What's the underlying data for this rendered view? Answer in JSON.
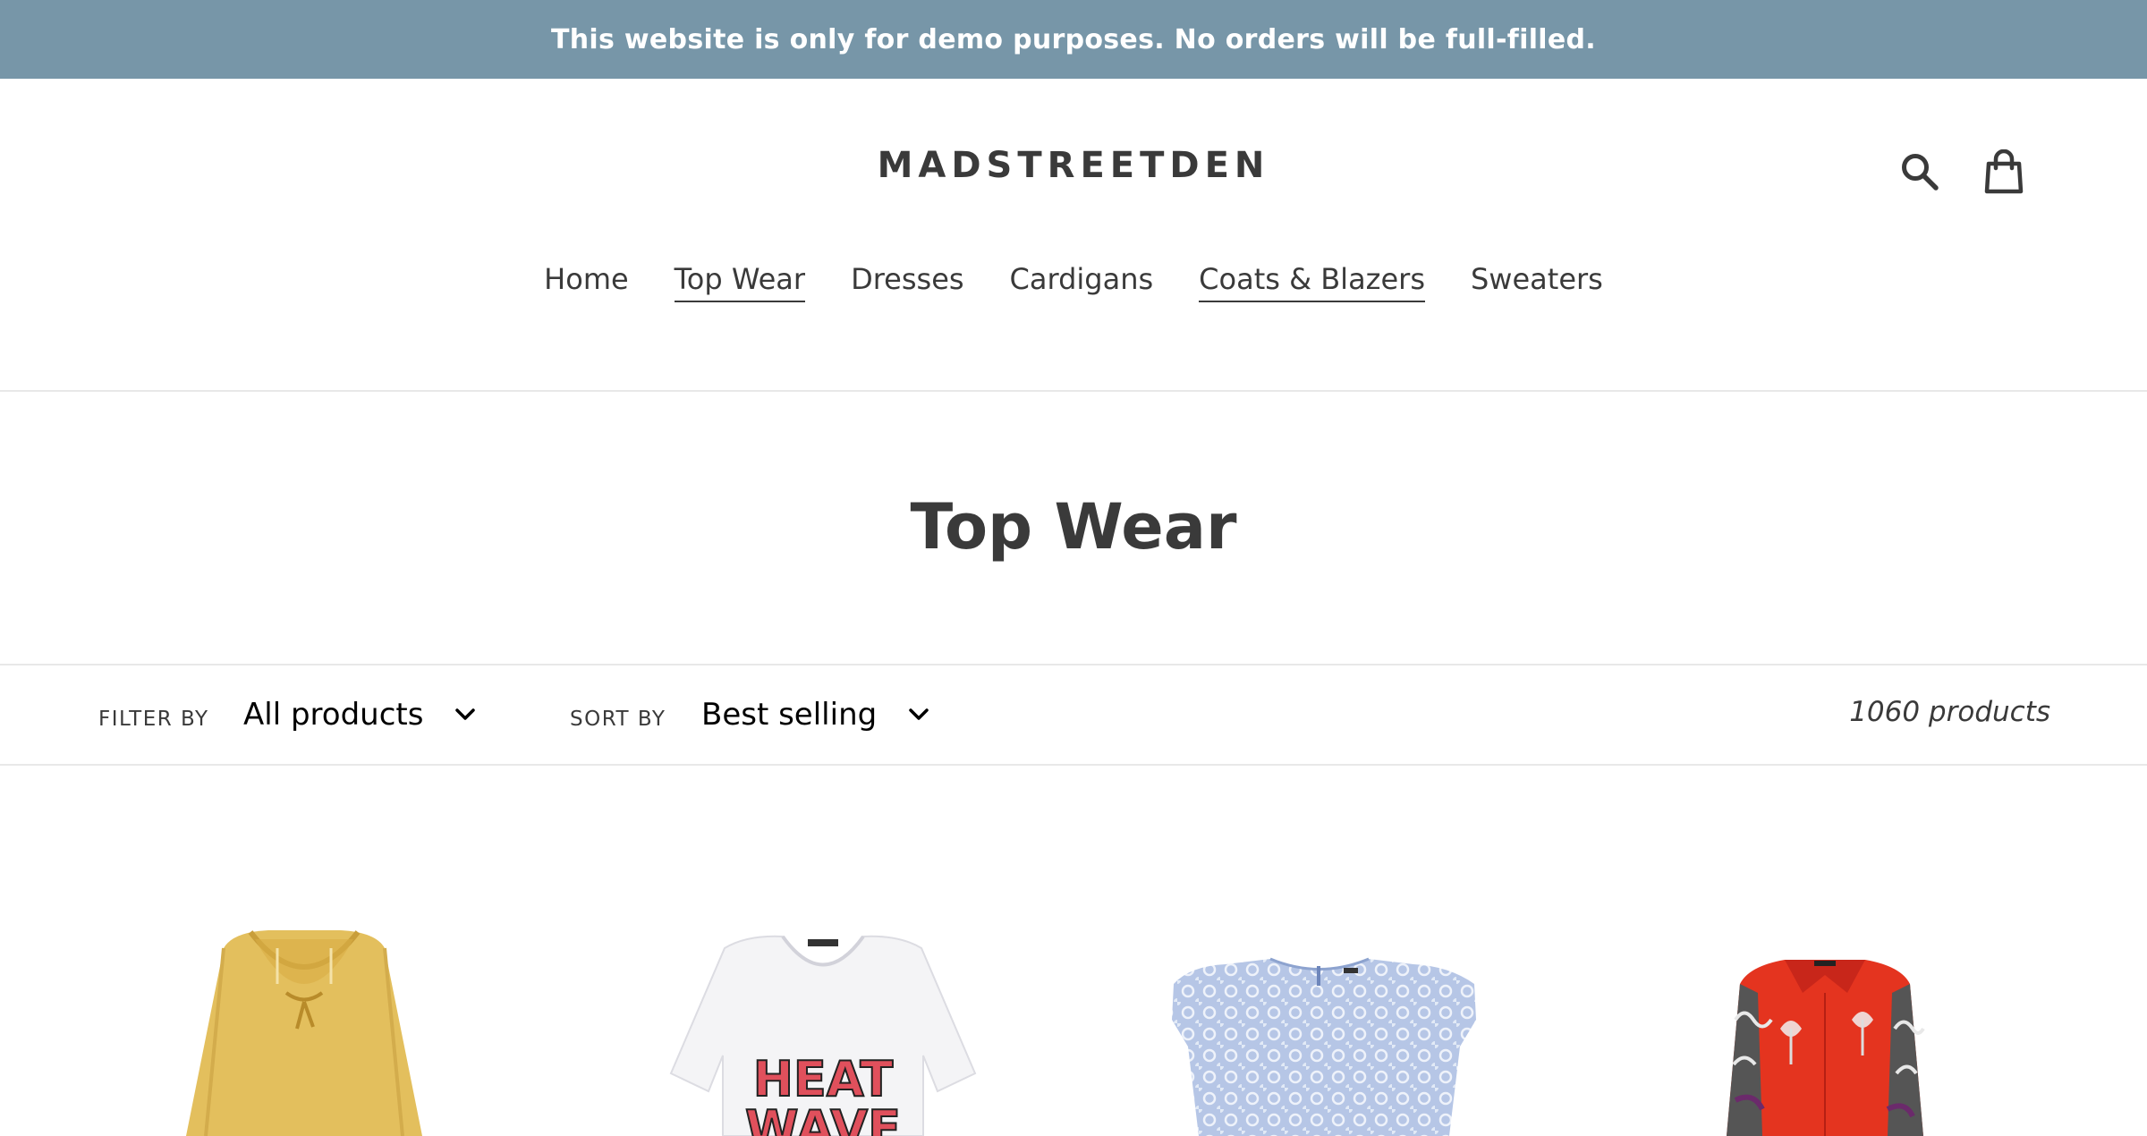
{
  "announcement": {
    "text": "This website is only for demo purposes. No orders will be full-filled."
  },
  "header": {
    "logo": "MADSTREETDEN",
    "icons": [
      "search-icon",
      "cart-icon"
    ]
  },
  "nav": {
    "items": [
      {
        "label": "Home",
        "active": false
      },
      {
        "label": "Top Wear",
        "active": true
      },
      {
        "label": "Dresses",
        "active": false
      },
      {
        "label": "Cardigans",
        "active": false
      },
      {
        "label": "Coats & Blazers",
        "active": true
      },
      {
        "label": "Sweaters",
        "active": false
      }
    ]
  },
  "collection": {
    "title": "Top Wear"
  },
  "toolbar": {
    "filter_label": "FILTER BY",
    "filter_value": "All products",
    "sort_label": "SORT BY",
    "sort_value": "Best selling",
    "product_count": "1060 products"
  },
  "products": [
    {
      "image": "yellow-ruffle-blouse",
      "color": "#e3bf5d"
    },
    {
      "image": "white-heat-wave-tshirt",
      "color": "#f4f4f6"
    },
    {
      "image": "light-blue-lace-top",
      "color": "#b6c6e6"
    },
    {
      "image": "red-floral-shirt",
      "color": "#e4341f"
    }
  ],
  "colors": {
    "announcement_bg": "#7796a8",
    "text": "#3a3a3a",
    "divider": "#e8e8e8"
  }
}
